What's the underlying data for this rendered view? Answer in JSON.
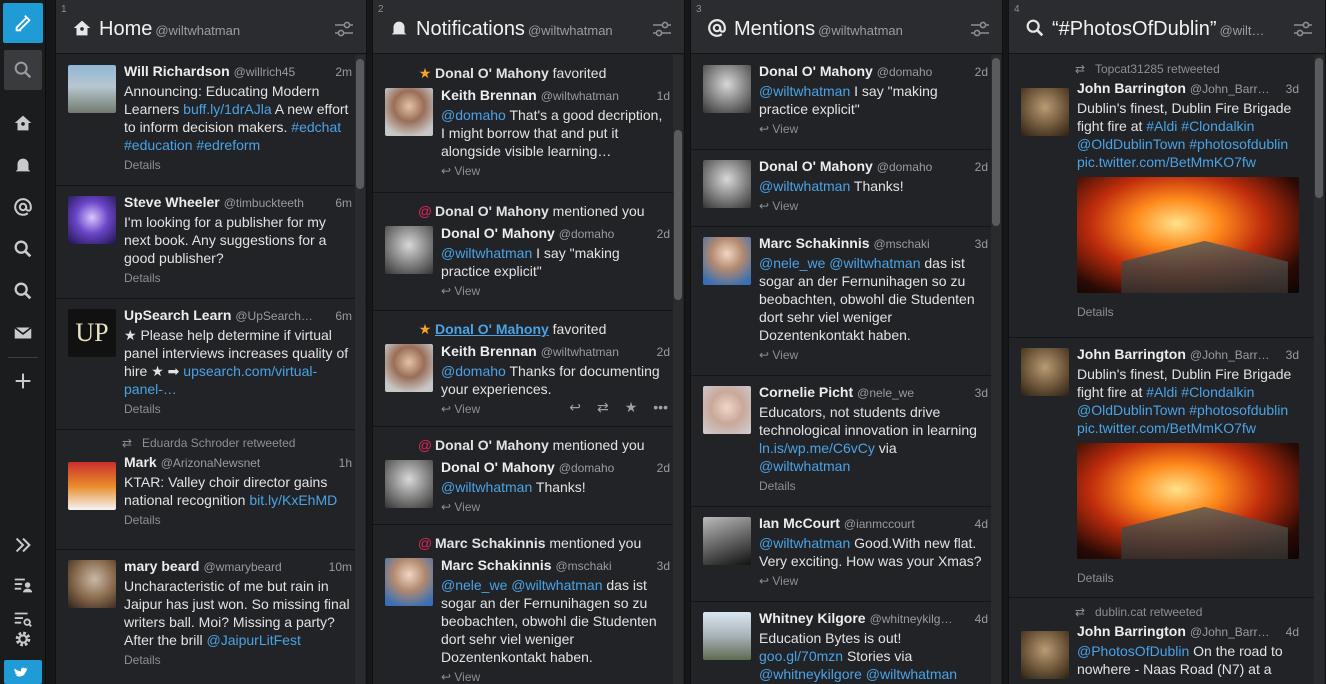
{
  "columns": [
    {
      "num": "1",
      "title": "Home",
      "handle": "@wiltwhatman",
      "tweets": [
        {
          "name": "Will Richardson",
          "handle": "@willrich45",
          "time": "2m",
          "text": [
            "Announcing: Educating Modern Learners ",
            "buff.ly/1drAJla",
            " A new effort to inform decision makers. ",
            "#edchat #education #edreform"
          ],
          "foot": "Details"
        },
        {
          "name": "Steve Wheeler",
          "handle": "@timbuckteeth",
          "time": "6m",
          "text": "I'm looking for a publisher for my next book. Any suggestions for a good publisher?",
          "foot": "Details"
        },
        {
          "name": "UpSearch Learn",
          "handle": "@UpSearch…",
          "time": "6m",
          "text_a": "★ Please help determine if virtual panel interviews increases quality of hire ★ ➡ ",
          "link": "upsearch.com/virtual-panel-…",
          "foot": "Details",
          "avatar_text": "UP"
        },
        {
          "retweet": "Eduarda Schroder retweeted",
          "name": "Mark",
          "handle": "@ArizonaNewsnet",
          "time": "1h",
          "text_a": "KTAR: Valley choir director gains national recognition ",
          "link": "bit.ly/KxEhMD",
          "foot": "Details"
        },
        {
          "name": "mary beard",
          "handle": "@wmarybeard",
          "time": "10m",
          "text_a": "Uncharacteristic of me but rain in Jaipur has just won. So missing final writers ball. Moi? Missing a party? After the brill ",
          "link": "@JaipurLitFest",
          "foot": "Details"
        }
      ]
    },
    {
      "num": "2",
      "title": "Notifications",
      "handle": "@wiltwhatman",
      "items": [
        {
          "notif_name": "Donal O' Mahony",
          "notif_action": " favorited",
          "kind": "fav",
          "name": "Keith Brennan",
          "handle": "@wiltwhatman",
          "time": "1d",
          "link": "@domaho",
          "text_b": " That's a good decription, I might borrow that and put it alongside visible learning…",
          "view": "View"
        },
        {
          "notif_name": "Donal O' Mahony",
          "notif_action": " mentioned you",
          "kind": "mention",
          "name": "Donal O' Mahony",
          "handle": "@domaho",
          "time": "2d",
          "link": "@wiltwhatman",
          "text_b": " I say \"making practice explicit\"",
          "view": "View"
        },
        {
          "notif_name": "Donal O' Mahony",
          "notif_action": " favorited",
          "kind": "fav",
          "name": "Keith Brennan",
          "handle": "@wiltwhatman",
          "time": "2d",
          "link": "@domaho",
          "text_b": " Thanks for documenting your experiences.",
          "view": "View"
        },
        {
          "notif_name": "Donal O' Mahony",
          "notif_action": " mentioned you",
          "kind": "mention",
          "name": "Donal O' Mahony",
          "handle": "@domaho",
          "time": "2d",
          "link": "@wiltwhatman",
          "text_b": " Thanks!",
          "view": "View"
        },
        {
          "notif_name": "Marc Schakinnis",
          "notif_action": " mentioned you",
          "kind": "mention",
          "name": "Marc Schakinnis",
          "handle": "@mschaki",
          "time": "3d",
          "link": "@nele_we @wiltwhatman",
          "text_b": " das ist sogar an der Fernunihagen so zu beobachten, obwohl die Studenten dort sehr viel weniger Dozentenkontakt haben.",
          "view": "View"
        }
      ]
    },
    {
      "num": "3",
      "title": "Mentions",
      "handle": "@wiltwhatman",
      "tweets": [
        {
          "name": "Donal O' Mahony",
          "handle": "@domaho",
          "time": "2d",
          "link": "@wiltwhatman",
          "text_b": " I say \"making practice explicit\"",
          "foot": "View"
        },
        {
          "name": "Donal O' Mahony",
          "handle": "@domaho",
          "time": "2d",
          "link": "@wiltwhatman",
          "text_b": " Thanks!",
          "foot": "View"
        },
        {
          "name": "Marc Schakinnis",
          "handle": "@mschaki",
          "time": "3d",
          "link": "@nele_we @wiltwhatman",
          "text_b": " das ist sogar an der Fernunihagen so zu beobachten, obwohl die Studenten dort sehr viel weniger Dozentenkontakt haben.",
          "foot": "View"
        },
        {
          "name": "Cornelie Picht",
          "handle": "@nele_we",
          "time": "3d",
          "text_a": "Educators, not students drive technological innovation in learning ",
          "link": "ln.is/wp.me/C6vCy",
          "text_b": " via ",
          "link2": "@wiltwhatman",
          "foot": "Details"
        },
        {
          "name": "Ian McCourt",
          "handle": "@ianmccourt",
          "time": "4d",
          "link": "@wiltwhatman",
          "text_b": " Good.With new flat. Very exciting. How was your Xmas?",
          "foot": "View"
        },
        {
          "name": "Whitney Kilgore",
          "handle": "@whitneykilg…",
          "time": "4d",
          "text_a": "Education Bytes is out! ",
          "link": "goo.gl/70mzn",
          "text_b": " Stories via ",
          "link2": "@whitneykilgore @wiltwhatman"
        }
      ]
    },
    {
      "num": "4",
      "title": "“#PhotosOfDublin”",
      "handle": "@wilt…",
      "tweets": [
        {
          "retweet": "Topcat31285 retweeted",
          "name": "John Barrington",
          "handle": "@John_Barr…",
          "time": "3d",
          "text_a": "Dublin's finest, Dublin Fire Brigade fight fire at ",
          "link": "#Aldi #Clondalkin @OldDublinTown #photosofdublin pic.twitter.com/BetMmKO7fw",
          "foot": "Details"
        },
        {
          "name": "John Barrington",
          "handle": "@John_Barr…",
          "time": "3d",
          "text_a": "Dublin's finest, Dublin Fire Brigade fight fire at ",
          "link": "#Aldi #Clondalkin @OldDublinTown #photosofdublin pic.twitter.com/BetMmKO7fw",
          "foot": "Details"
        },
        {
          "retweet": "dublin.cat retweeted",
          "name": "John Barrington",
          "handle": "@John_Barr…",
          "time": "4d",
          "link": "@PhotosOfDublin",
          "text_b": "  On the road to nowhere - Naas Road (N7) at a"
        }
      ]
    }
  ],
  "actions": [
    "reply",
    "retweet",
    "favorite",
    "more"
  ]
}
